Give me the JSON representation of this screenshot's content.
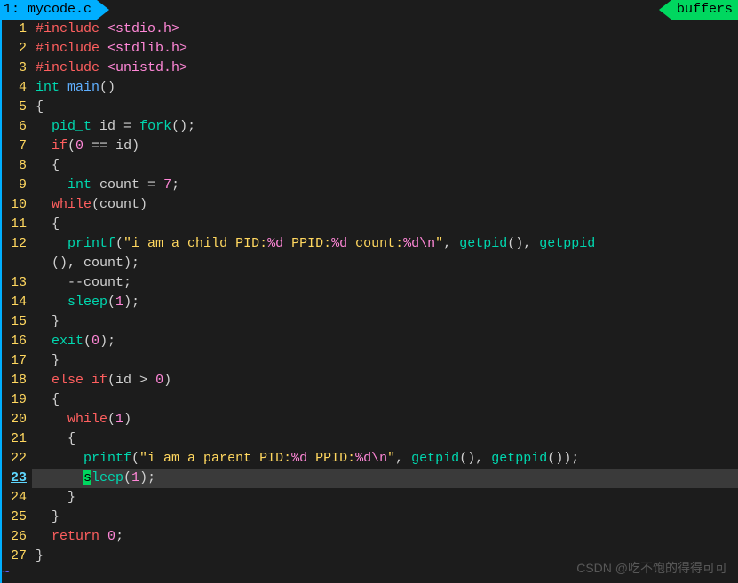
{
  "tab": {
    "index": "1:",
    "filename": "mycode.c"
  },
  "buffers_label": "buffers",
  "current_line": 23,
  "watermark": "CSDN @吃不饱的得得可可",
  "lines": [
    {
      "n": 1,
      "tokens": [
        [
          "pp",
          "#include "
        ],
        [
          "hdr",
          "<stdio.h>"
        ]
      ]
    },
    {
      "n": 2,
      "tokens": [
        [
          "pp",
          "#include "
        ],
        [
          "hdr",
          "<stdlib.h>"
        ]
      ]
    },
    {
      "n": 3,
      "tokens": [
        [
          "pp",
          "#include "
        ],
        [
          "hdr",
          "<unistd.h>"
        ]
      ]
    },
    {
      "n": 4,
      "tokens": [
        [
          "type",
          "int "
        ],
        [
          "mainfn",
          "main"
        ],
        [
          "op",
          "()"
        ]
      ]
    },
    {
      "n": 5,
      "tokens": [
        [
          "op",
          "{"
        ]
      ]
    },
    {
      "n": 6,
      "tokens": [
        [
          "id",
          "  "
        ],
        [
          "type",
          "pid_t"
        ],
        [
          "id",
          " id "
        ],
        [
          "op",
          "= "
        ],
        [
          "func",
          "fork"
        ],
        [
          "op",
          "();"
        ]
      ]
    },
    {
      "n": 7,
      "tokens": [
        [
          "id",
          "  "
        ],
        [
          "kw",
          "if"
        ],
        [
          "op",
          "("
        ],
        [
          "num",
          "0"
        ],
        [
          "op",
          " == id)"
        ]
      ]
    },
    {
      "n": 8,
      "tokens": [
        [
          "id",
          "  "
        ],
        [
          "op",
          "{"
        ]
      ]
    },
    {
      "n": 9,
      "tokens": [
        [
          "id",
          "    "
        ],
        [
          "type",
          "int"
        ],
        [
          "id",
          " count "
        ],
        [
          "op",
          "= "
        ],
        [
          "num",
          "7"
        ],
        [
          "op",
          ";"
        ]
      ]
    },
    {
      "n": 10,
      "tokens": [
        [
          "id",
          "  "
        ],
        [
          "kw",
          "while"
        ],
        [
          "op",
          "(count)"
        ]
      ]
    },
    {
      "n": 11,
      "tokens": [
        [
          "id",
          "  "
        ],
        [
          "op",
          "{"
        ]
      ]
    },
    {
      "n": 12,
      "tokens": [
        [
          "id",
          "    "
        ],
        [
          "func",
          "printf"
        ],
        [
          "op",
          "("
        ],
        [
          "str",
          "\"i am a child PID:"
        ],
        [
          "fmt",
          "%d"
        ],
        [
          "str",
          " PPID:"
        ],
        [
          "fmt",
          "%d"
        ],
        [
          "str",
          " count:"
        ],
        [
          "fmt",
          "%d"
        ],
        [
          "esc",
          "\\n"
        ],
        [
          "str",
          "\""
        ],
        [
          "op",
          ", "
        ],
        [
          "func",
          "getpid"
        ],
        [
          "op",
          "(), "
        ],
        [
          "func",
          "getppid"
        ]
      ]
    },
    {
      "n": 0,
      "cont": true,
      "tokens": [
        [
          "id",
          "  "
        ],
        [
          "op",
          "(), count);"
        ]
      ]
    },
    {
      "n": 13,
      "tokens": [
        [
          "id",
          "    --count;"
        ]
      ]
    },
    {
      "n": 14,
      "tokens": [
        [
          "id",
          "    "
        ],
        [
          "func",
          "sleep"
        ],
        [
          "op",
          "("
        ],
        [
          "num",
          "1"
        ],
        [
          "op",
          ");"
        ]
      ]
    },
    {
      "n": 15,
      "tokens": [
        [
          "id",
          "  "
        ],
        [
          "op",
          "}"
        ]
      ]
    },
    {
      "n": 16,
      "tokens": [
        [
          "id",
          "  "
        ],
        [
          "func",
          "exit"
        ],
        [
          "op",
          "("
        ],
        [
          "num",
          "0"
        ],
        [
          "op",
          ");"
        ]
      ]
    },
    {
      "n": 17,
      "tokens": [
        [
          "id",
          "  "
        ],
        [
          "op",
          "}"
        ]
      ]
    },
    {
      "n": 18,
      "tokens": [
        [
          "id",
          "  "
        ],
        [
          "kw",
          "else if"
        ],
        [
          "op",
          "(id "
        ],
        [
          "op",
          ">"
        ],
        [
          "op",
          " "
        ],
        [
          "num",
          "0"
        ],
        [
          "op",
          ")"
        ]
      ]
    },
    {
      "n": 19,
      "tokens": [
        [
          "id",
          "  "
        ],
        [
          "op",
          "{"
        ]
      ]
    },
    {
      "n": 20,
      "tokens": [
        [
          "id",
          "    "
        ],
        [
          "kw",
          "while"
        ],
        [
          "op",
          "("
        ],
        [
          "num",
          "1"
        ],
        [
          "op",
          ")"
        ]
      ]
    },
    {
      "n": 21,
      "tokens": [
        [
          "id",
          "    "
        ],
        [
          "op",
          "{"
        ]
      ]
    },
    {
      "n": 22,
      "tokens": [
        [
          "id",
          "      "
        ],
        [
          "func",
          "printf"
        ],
        [
          "op",
          "("
        ],
        [
          "str",
          "\"i am a parent PID:"
        ],
        [
          "fmt",
          "%d"
        ],
        [
          "str",
          " PPID:"
        ],
        [
          "fmt",
          "%d"
        ],
        [
          "esc",
          "\\n"
        ],
        [
          "str",
          "\""
        ],
        [
          "op",
          ", "
        ],
        [
          "func",
          "getpid"
        ],
        [
          "op",
          "(), "
        ],
        [
          "func",
          "getppid"
        ],
        [
          "op",
          "());"
        ]
      ]
    },
    {
      "n": 23,
      "current": true,
      "tokens": [
        [
          "id",
          "      "
        ],
        [
          "cursor",
          "s"
        ],
        [
          "func",
          "leep"
        ],
        [
          "op",
          "("
        ],
        [
          "num",
          "1"
        ],
        [
          "op",
          ");"
        ]
      ]
    },
    {
      "n": 24,
      "tokens": [
        [
          "id",
          "    "
        ],
        [
          "op",
          "}"
        ]
      ]
    },
    {
      "n": 25,
      "tokens": [
        [
          "id",
          "  "
        ],
        [
          "op",
          "}"
        ]
      ]
    },
    {
      "n": 26,
      "tokens": [
        [
          "id",
          "  "
        ],
        [
          "kw",
          "return"
        ],
        [
          "op",
          " "
        ],
        [
          "num",
          "0"
        ],
        [
          "op",
          ";"
        ]
      ]
    },
    {
      "n": 27,
      "tokens": [
        [
          "op",
          "}"
        ]
      ]
    }
  ]
}
